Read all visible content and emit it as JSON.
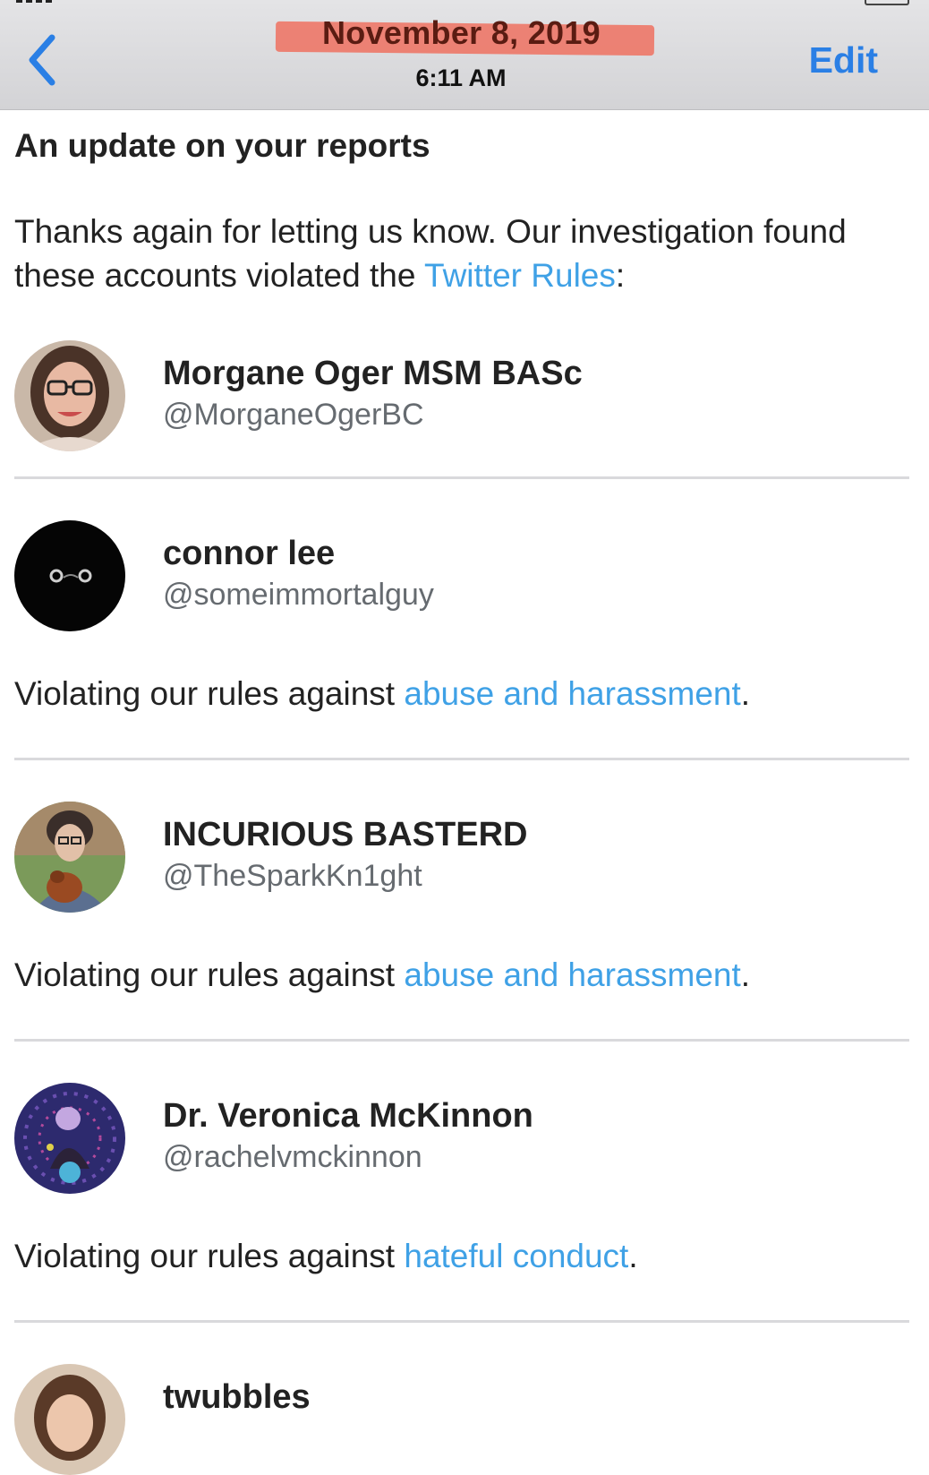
{
  "header": {
    "back_icon": "chevron-left-icon",
    "date": "November 8, 2019",
    "time": "6:11 AM",
    "edit_label": "Edit",
    "accent_color": "#2a7fe5",
    "highlight_color": "#ef6c5c"
  },
  "message": {
    "title": "An update on your reports",
    "intro_before": "Thanks again for letting us know. Our investigation found these accounts violated the ",
    "intro_link": "Twitter Rules",
    "intro_after": ":",
    "link_color": "#3fa1e6"
  },
  "accounts": [
    {
      "name": "Morgane Oger MSM BASc",
      "handle": "@MorganeOgerBC"
    },
    {
      "name": "connor lee",
      "handle": "@someimmortalguy",
      "violation_prefix": "Violating our rules against ",
      "violation_link": "abuse and harassment",
      "violation_suffix": "."
    },
    {
      "name": "INCURIOUS BASTERD",
      "handle": "@TheSparkKn1ght",
      "violation_prefix": "Violating our rules against ",
      "violation_link": "abuse and harassment",
      "violation_suffix": "."
    },
    {
      "name": "Dr. Veronica McKinnon",
      "handle": "@rachelvmckinnon",
      "violation_prefix": "Violating our rules against ",
      "violation_link": "hateful conduct",
      "violation_suffix": "."
    },
    {
      "name": "twubbles"
    }
  ]
}
